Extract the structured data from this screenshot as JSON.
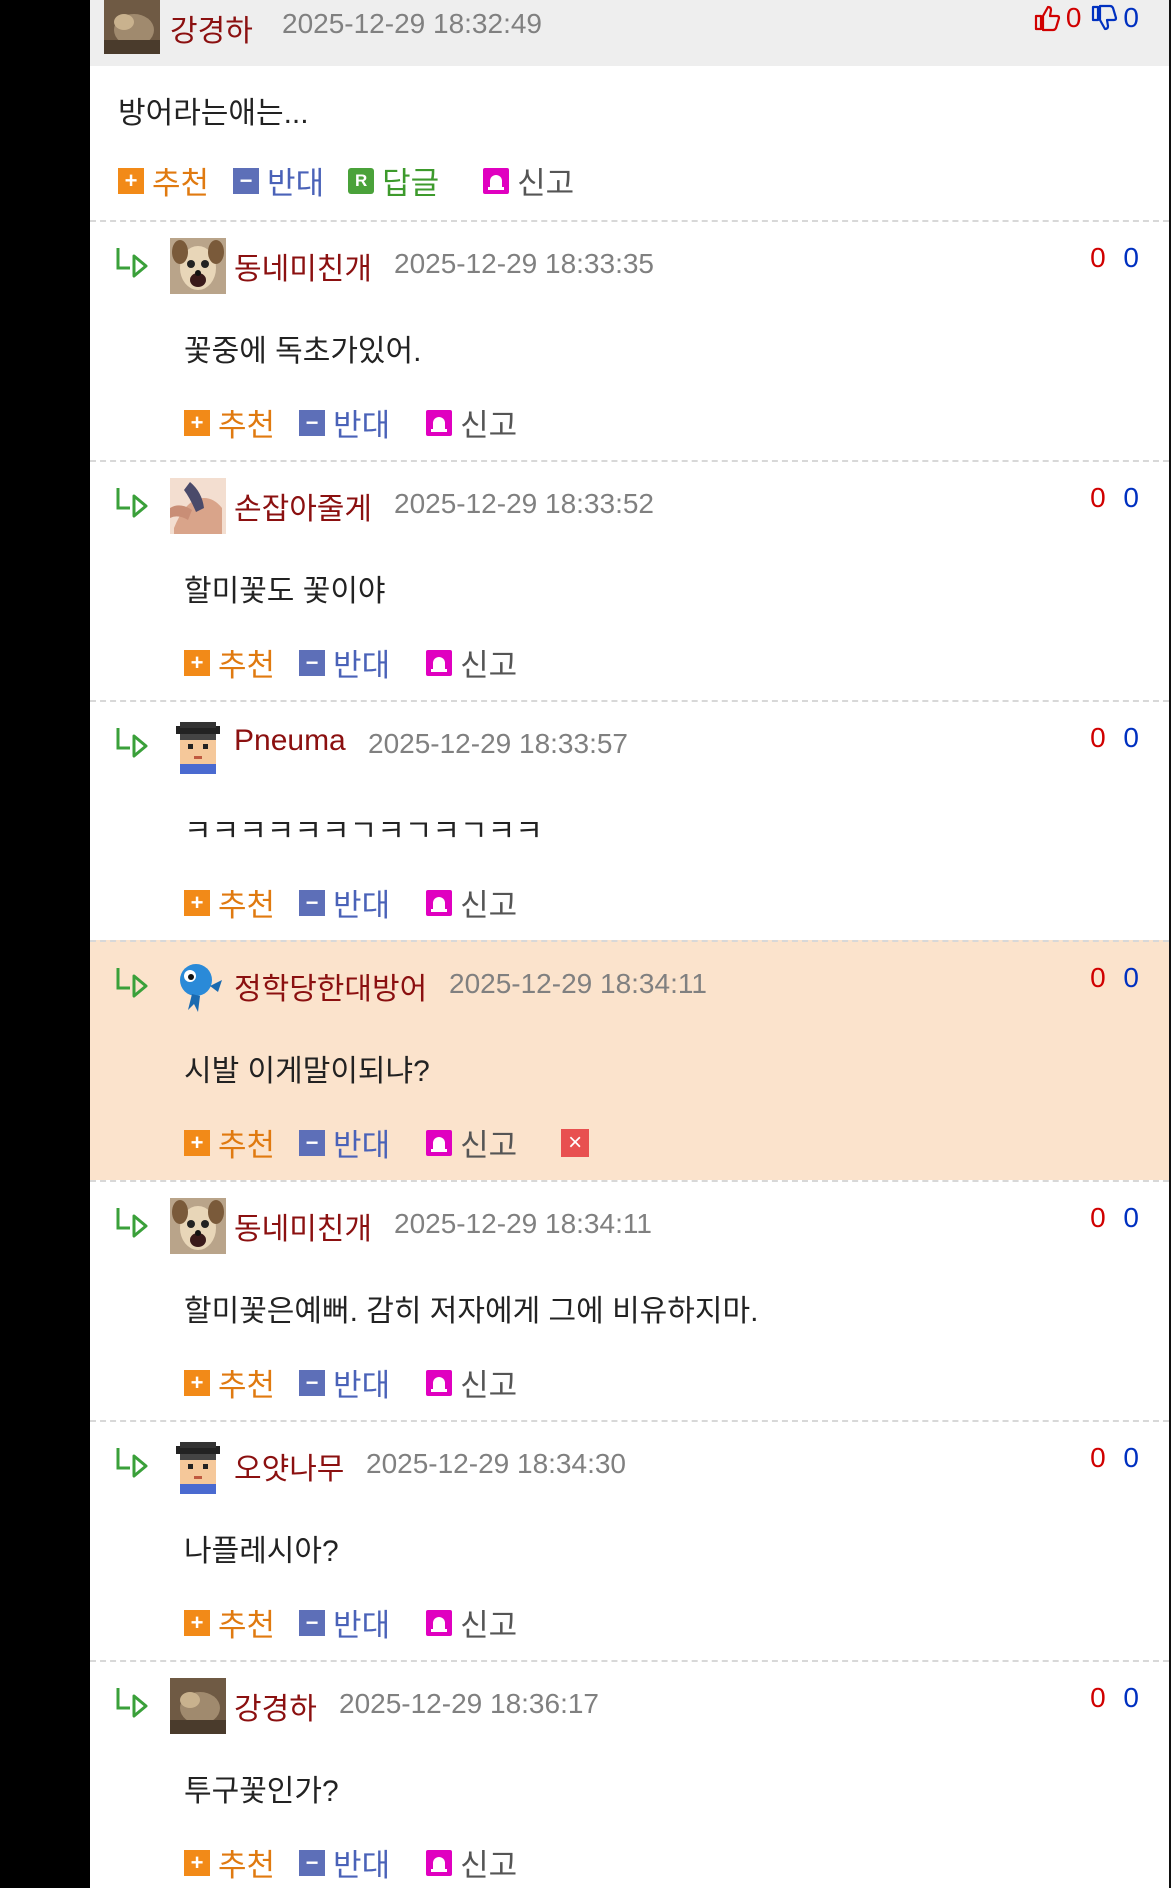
{
  "main_comment": {
    "nickname": "강경하",
    "datetime": "2025-12-29 18:32:49",
    "up_count": "0",
    "down_count": "0",
    "body": "방어라는애는...",
    "actions": {
      "recommend": "추천",
      "oppose": "반대",
      "reply": "답글",
      "report": "신고"
    }
  },
  "reply_actions": {
    "recommend": "추천",
    "oppose": "반대",
    "report": "신고"
  },
  "replies": [
    {
      "nickname": "동네미친개",
      "datetime": "2025-12-29 18:33:35",
      "body": "꽃중에 독초가있어.",
      "up": "0",
      "down": "0",
      "avatar": "dog-avatar"
    },
    {
      "nickname": "손잡아줄게",
      "datetime": "2025-12-29 18:33:52",
      "body": "할미꽃도 꽃이야",
      "up": "0",
      "down": "0",
      "avatar": "hands-avatar"
    },
    {
      "nickname": "Pneuma",
      "datetime": "2025-12-29 18:33:57",
      "body": "ㅋㅋㅋㅋㅋㅋㄱㅋㄱㅋㄱㅋㅋ",
      "up": "0",
      "down": "0",
      "avatar": "pixel-boy-avatar"
    },
    {
      "nickname": "정학당한대방어",
      "datetime": "2025-12-29 18:34:11",
      "body": "시발 이게말이되냐?",
      "up": "0",
      "down": "0",
      "avatar": "blue-fish-avatar",
      "highlighted": true
    },
    {
      "nickname": "동네미친개",
      "datetime": "2025-12-29 18:34:11",
      "body": "할미꽃은예뻐. 감히 저자에게 그에 비유하지마.",
      "up": "0",
      "down": "0",
      "avatar": "dog-avatar"
    },
    {
      "nickname": "오얏나무",
      "datetime": "2025-12-29 18:34:30",
      "body": "나플레시아?",
      "up": "0",
      "down": "0",
      "avatar": "pixel-boy-avatar"
    },
    {
      "nickname": "강경하",
      "datetime": "2025-12-29 18:36:17",
      "body": "투구꽃인가?",
      "up": "0",
      "down": "0",
      "avatar": "photo-avatar"
    }
  ],
  "colors": {
    "nickname": "#8b1010",
    "up": "#d00000",
    "down": "#0030c0",
    "highlight_bg": "#fbe3cc",
    "recommend": "#f28a18",
    "oppose": "#5d6fb8",
    "reply": "#4aa23a",
    "report": "#e000c0"
  }
}
